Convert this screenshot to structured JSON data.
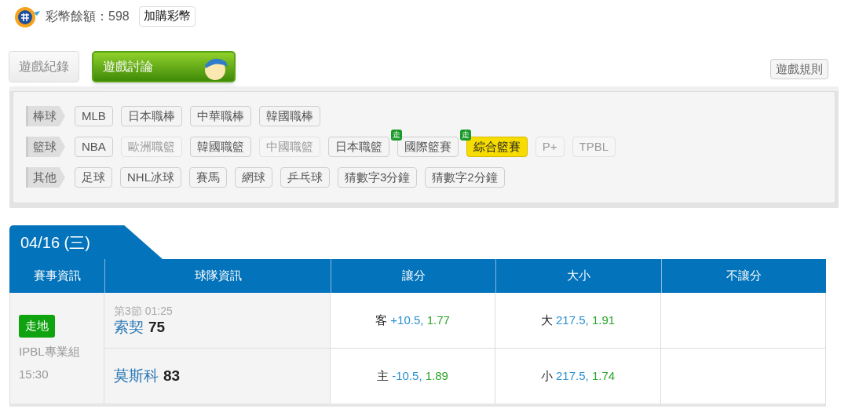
{
  "balance": {
    "text": "彩幣餘額：598",
    "buy_button": "加購彩幣"
  },
  "tabs": [
    {
      "label": "遊戲紀錄",
      "selected": false
    },
    {
      "label": "遊戲討論",
      "selected": true
    }
  ],
  "rules_button": "遊戲規則",
  "categories": [
    {
      "label": "棒球",
      "leagues": [
        {
          "label": "MLB",
          "disabled": false,
          "selected": false
        },
        {
          "label": "日本職棒",
          "disabled": false,
          "selected": false
        },
        {
          "label": "中華職棒",
          "disabled": false,
          "selected": false
        },
        {
          "label": "韓國職棒",
          "disabled": false,
          "selected": false
        }
      ]
    },
    {
      "label": "籃球",
      "leagues": [
        {
          "label": "NBA",
          "disabled": false,
          "selected": false
        },
        {
          "label": "歐洲職籃",
          "disabled": true,
          "selected": false
        },
        {
          "label": "韓國職籃",
          "disabled": false,
          "selected": false
        },
        {
          "label": "中國職籃",
          "disabled": true,
          "selected": false
        },
        {
          "label": "日本職籃",
          "disabled": false,
          "selected": false
        },
        {
          "label": "國際籃賽",
          "disabled": false,
          "selected": false,
          "live_badge": "走"
        },
        {
          "label": "綜合籃賽",
          "disabled": false,
          "selected": true,
          "live_badge": "走"
        },
        {
          "label": "P+",
          "disabled": true,
          "selected": false
        },
        {
          "label": "TPBL",
          "disabled": true,
          "selected": false
        }
      ]
    },
    {
      "label": "其他",
      "leagues": [
        {
          "label": "足球",
          "disabled": false,
          "selected": false
        },
        {
          "label": "NHL冰球",
          "disabled": false,
          "selected": false
        },
        {
          "label": "賽馬",
          "disabled": false,
          "selected": false
        },
        {
          "label": "網球",
          "disabled": false,
          "selected": false
        },
        {
          "label": "乒乓球",
          "disabled": false,
          "selected": false
        },
        {
          "label": "猜數字3分鐘",
          "disabled": false,
          "selected": false
        },
        {
          "label": "猜數字2分鐘",
          "disabled": false,
          "selected": false
        }
      ]
    }
  ],
  "date_tab": "04/16 (三)",
  "table": {
    "columns": [
      "賽事資訊",
      "球隊資訊",
      "讓分",
      "大小",
      "不讓分"
    ],
    "game": {
      "status_badge": "走地",
      "league": "IPBL專業組",
      "time": "15:30",
      "period": "第3節 01:25",
      "teams": [
        {
          "name": "索契",
          "score": "75",
          "spread": {
            "side": "客",
            "line": "+10.5,",
            "price": "1.77"
          },
          "total": {
            "side": "大",
            "line": "217.5,",
            "price": "1.91"
          }
        },
        {
          "name": "莫斯科",
          "score": "83",
          "spread": {
            "side": "主",
            "line": "-10.5,",
            "price": "1.89"
          },
          "total": {
            "side": "小",
            "line": "217.5,",
            "price": "1.74"
          }
        }
      ]
    }
  }
}
